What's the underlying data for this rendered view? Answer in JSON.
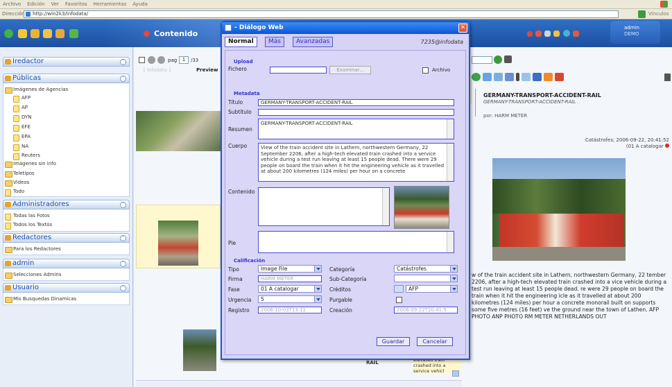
{
  "browser": {
    "menu": [
      "Archivo",
      "Edición",
      "Ver",
      "Favoritos",
      "Herramientas",
      "Ayuda"
    ],
    "address_label": "Dirección",
    "url": "http://win2k3/infodata/",
    "links_label": "Vínculos"
  },
  "header": {
    "section": "Contenido",
    "user": "admin",
    "user_sub": "DEMO"
  },
  "sidebar": {
    "redactor": "Iredactor",
    "publicas": "Públicas",
    "tree": [
      "Imágenes de Agencias",
      "AFP",
      "AP",
      "DYN",
      "EFE",
      "EPA",
      "NA",
      "Reuters",
      "Imágenes sin info",
      "Teletipos",
      "Videos",
      "Todo"
    ],
    "administradores": "Administradores",
    "admin_items": [
      "Todas las Fotos",
      "Todos los Textos"
    ],
    "redactores": "Redactores",
    "redactores_items": [
      "Para los Redactores"
    ],
    "admin": "admin",
    "admin_sub": [
      "Selecciones Admins"
    ],
    "usuario": "Usuario",
    "usuario_items": [
      "Mis Busquedas Dinamicas"
    ]
  },
  "content": {
    "pag_label": "pag",
    "pag_value": "1",
    "pag_of": "/33",
    "infodata_tag": "[ Infodata ]",
    "preview_label": "Preview",
    "caption_rail": "RAIL",
    "caption_snip": "elevated train crashed into a service vehicl"
  },
  "detail": {
    "title": "GERMANY-TRANSPORT-ACCIDENT-RAIL",
    "subtitle": "GERMANY-TRANSPORT-ACCIDENT-RAIL",
    "by": "por: HARM METER",
    "meta": "Catástrofes; 2006-09-22, 20:41:52",
    "status": "(01 A catalogar",
    "body": "w of the train accident site in Lathern, northwestern Germany, 22 tember 2206, after a high-tech elevated train crashed into a vice vehicle during a test run leaving at least 15 people dead. re were 29 people on board the train when it hit the engineering icle as it travelled at about 200 kilometres (124 miles) per hour a concrete monorail built on supports some five metres (16 feet) ve the ground near the town of Lathen. AFP PHOTO ANP PHOTO RM METER NETHERLANDS OUT"
  },
  "dialog": {
    "title": "- Diálogo Web",
    "tabs": [
      "Normal",
      "Más",
      "Avanzadas"
    ],
    "user": "7235@infodata",
    "upload_h": "Upload",
    "fichero_lbl": "Fichero",
    "examinar": "Examinar...",
    "archivo_lbl": "Archivo",
    "metadata_h": "Metadata",
    "titulo_lbl": "Título",
    "titulo_val": "GERMANY-TRANSPORT-ACCIDENT-RAIL",
    "subtitulo_lbl": "Subtítulo",
    "resumen_lbl": "Resumen",
    "resumen_val": "GERMANY-TRANSPORT-ACCIDENT-RAIL",
    "cuerpo_lbl": "Cuerpo",
    "cuerpo_val": "View of the train accident site in Lathern, northwestern Germany, 22 September 2206, after a high-tech elevated train crashed into a service vehicle during a test run leaving at least 15 people dead. There were 29 people on board the train when it hit the engineering vehicle as it travelled at about 200 kilometres (124 miles) per hour on a concrete",
    "contenido_lbl": "Contenido",
    "pie_lbl": "Pie",
    "calif_h": "Calificación",
    "tipo_lbl": "Tipo",
    "tipo_val": "Image File",
    "categoria_lbl": "Categoría",
    "categoria_val": "Catástrofes",
    "firma_lbl": "Firma",
    "firma_val": "HARM METER",
    "subcat_lbl": "Sub-Categoría",
    "fase_lbl": "Fase",
    "fase_val": "01 A catalogar",
    "creditos_lbl": "Créditos",
    "creditos_val": "AFP",
    "urgencia_lbl": "Urgencia",
    "urgencia_val": "5",
    "purgable_lbl": "Purgable",
    "registro_lbl": "Registro",
    "registro_val": "2006-10-03T13:11",
    "creacion_lbl": "Creación",
    "creacion_val": "2006-09-22T20:41:5",
    "guardar": "Guardar",
    "cancelar": "Cancelar"
  },
  "colors": {
    "titlebar": "#0a55d8",
    "dialog_bg": "#d6d3f5",
    "tab_accent": "#3030c8",
    "header_blue": "#1d4fa0"
  }
}
